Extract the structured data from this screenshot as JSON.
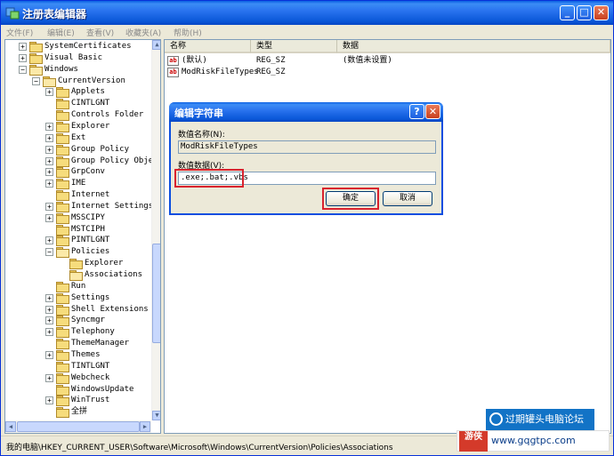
{
  "window": {
    "title": "注册表编辑器",
    "icon": "regedit-icon",
    "controls": [
      "minimize-icon",
      "maximize-icon",
      "close-icon"
    ]
  },
  "menu": [
    "文件(F)",
    "编辑(E)",
    "查看(V)",
    "收藏夹(A)",
    "帮助(H)"
  ],
  "tree": [
    {
      "label": "SystemCertificates",
      "level": 1,
      "expander": "+"
    },
    {
      "label": "Visual Basic",
      "level": 1,
      "expander": "+"
    },
    {
      "label": "Windows",
      "level": 1,
      "expander": "-",
      "open": true
    },
    {
      "label": "CurrentVersion",
      "level": 2,
      "expander": "-",
      "open": true
    },
    {
      "label": "Applets",
      "level": 3,
      "expander": "+"
    },
    {
      "label": "CINTLGNT",
      "level": 3,
      "expander": ""
    },
    {
      "label": "Controls Folder",
      "level": 3,
      "expander": ""
    },
    {
      "label": "Explorer",
      "level": 3,
      "expander": "+"
    },
    {
      "label": "Ext",
      "level": 3,
      "expander": "+"
    },
    {
      "label": "Group Policy",
      "level": 3,
      "expander": "+"
    },
    {
      "label": "Group Policy Objec",
      "level": 3,
      "expander": "+"
    },
    {
      "label": "GrpConv",
      "level": 3,
      "expander": "+"
    },
    {
      "label": "IME",
      "level": 3,
      "expander": "+"
    },
    {
      "label": "Internet",
      "level": 3,
      "expander": ""
    },
    {
      "label": "Internet Settings",
      "level": 3,
      "expander": "+"
    },
    {
      "label": "MSSCIPY",
      "level": 3,
      "expander": "+"
    },
    {
      "label": "MSTCIPH",
      "level": 3,
      "expander": ""
    },
    {
      "label": "PINTLGNT",
      "level": 3,
      "expander": "+"
    },
    {
      "label": "Policies",
      "level": 3,
      "expander": "-",
      "open": true
    },
    {
      "label": "Explorer",
      "level": 4,
      "expander": ""
    },
    {
      "label": "Associations",
      "level": 4,
      "expander": "",
      "open": true
    },
    {
      "label": "Run",
      "level": 3,
      "expander": ""
    },
    {
      "label": "Settings",
      "level": 3,
      "expander": "+"
    },
    {
      "label": "Shell Extensions",
      "level": 3,
      "expander": "+"
    },
    {
      "label": "Syncmgr",
      "level": 3,
      "expander": "+"
    },
    {
      "label": "Telephony",
      "level": 3,
      "expander": "+"
    },
    {
      "label": "ThemeManager",
      "level": 3,
      "expander": ""
    },
    {
      "label": "Themes",
      "level": 3,
      "expander": "+"
    },
    {
      "label": "TINTLGNT",
      "level": 3,
      "expander": ""
    },
    {
      "label": "Webcheck",
      "level": 3,
      "expander": "+"
    },
    {
      "label": "WindowsUpdate",
      "level": 3,
      "expander": ""
    },
    {
      "label": "WinTrust",
      "level": 3,
      "expander": "+"
    },
    {
      "label": "全拼",
      "level": 3,
      "expander": ""
    }
  ],
  "list": {
    "columns": [
      "名称",
      "类型",
      "数据"
    ],
    "rows": [
      {
        "name": "(默认)",
        "type": "REG_SZ",
        "data": "(数值未设置)"
      },
      {
        "name": "ModRiskFileTypes",
        "type": "REG_SZ",
        "data": ""
      }
    ]
  },
  "dialog": {
    "title": "编辑字符串",
    "name_label": "数值名称(N):",
    "name_value": "ModRiskFileTypes",
    "data_label": "数值数据(V):",
    "data_value": ".exe;.bat;.vbs",
    "ok_label": "确定",
    "cancel_label": "取消",
    "help_glyph": "?",
    "close_glyph": "✕",
    "highlight_color": "#d9232e"
  },
  "status": {
    "path": "我的电脑\\HKEY_CURRENT_USER\\Software\\Microsoft\\Windows\\CurrentVersion\\Policies\\Associations"
  },
  "watermark": {
    "forum": "过期罐头电脑论坛",
    "logo": "游侠",
    "url": "www.gqgtpc.com"
  },
  "colors": {
    "titlebar": "#0a57d8",
    "window_bg": "#ece9d8",
    "highlight": "#d9232e"
  }
}
